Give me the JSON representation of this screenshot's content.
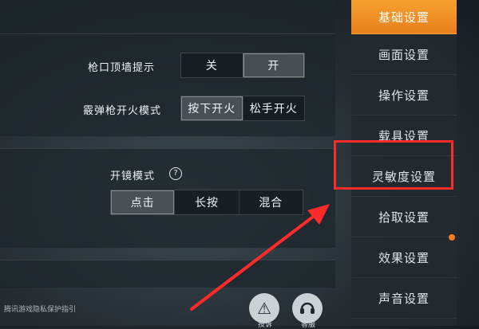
{
  "panel": {
    "row1": {
      "label": "枪口顶墙提示",
      "options": [
        "关",
        "开"
      ],
      "selected": 1
    },
    "row2": {
      "label": "霰弹枪开火模式",
      "options": [
        "按下开火",
        "松手开火"
      ],
      "selected": 0
    },
    "row3": {
      "label": "开镜模式",
      "help_glyph": "?",
      "options": [
        "点击",
        "长按",
        "混合"
      ],
      "selected": 0
    }
  },
  "sidebar": {
    "items": [
      {
        "label": "基础设置",
        "active": true
      },
      {
        "label": "画面设置",
        "active": false
      },
      {
        "label": "操作设置",
        "active": false
      },
      {
        "label": "载具设置",
        "active": false
      },
      {
        "label": "灵敏度设置",
        "active": false,
        "highlighted": true
      },
      {
        "label": "拾取设置",
        "active": false
      },
      {
        "label": "效果设置",
        "active": false,
        "notification": true
      },
      {
        "label": "声音设置",
        "active": false
      }
    ]
  },
  "footer": {
    "privacy_link": "腾讯游戏隐私保护指引",
    "report_label": "投诉",
    "support_label": "客服"
  },
  "colors": {
    "accent": "#f08a22",
    "annotation": "#ff2a2a"
  }
}
